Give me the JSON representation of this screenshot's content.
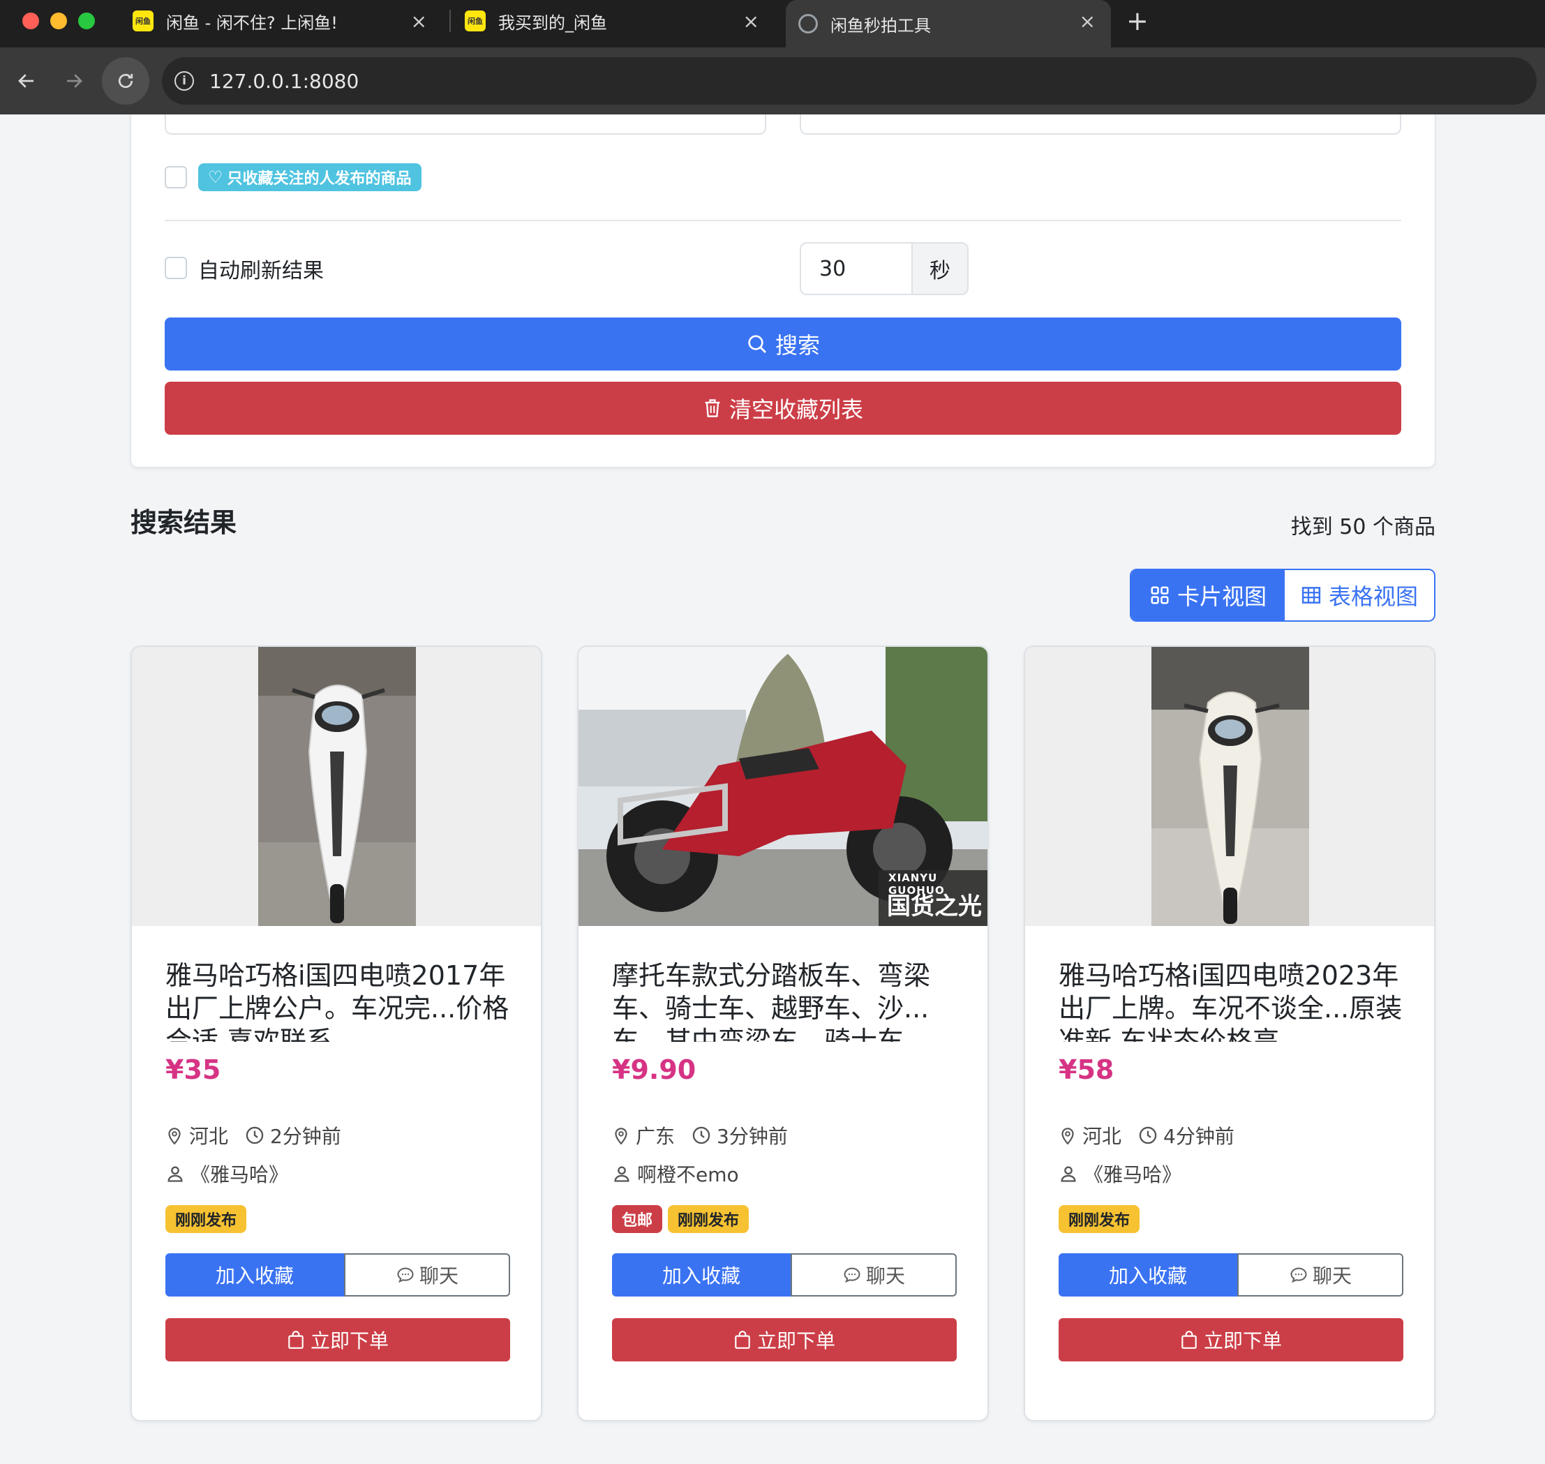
{
  "browser": {
    "tabs": [
      {
        "title": "闲鱼 - 闲不住? 上闲鱼!",
        "favicon": "xianyu-favicon"
      },
      {
        "title": "我买到的_闲鱼",
        "favicon": "xianyu-favicon"
      },
      {
        "title": "闲鱼秒拍工具",
        "favicon": "globe-icon",
        "active": true
      }
    ],
    "url": "127.0.0.1:8080"
  },
  "search_panel": {
    "follow_only_label": "只收藏关注的人发布的商品",
    "auto_refresh_label": "自动刷新结果",
    "refresh_interval": "30",
    "refresh_unit": "秒",
    "search_button": "搜索",
    "clear_button": "清空收藏列表"
  },
  "results": {
    "title": "搜索结果",
    "count_text": "找到 50 个商品",
    "view_card": "卡片视图",
    "view_table": "表格视图"
  },
  "items": [
    {
      "title": "雅马哈巧格i国四电喷2017年出厂上牌公户。车况完...价格合适 喜欢联系",
      "price": "¥35",
      "location": "河北",
      "time": "2分钟前",
      "seller": "《雅马哈》",
      "tags": [
        "刚刚发布"
      ],
      "fav_button": "加入收藏",
      "chat_button": "聊天",
      "order_button": "立即下单",
      "image": "white-scooter-photo"
    },
    {
      "title": "摩托车款式分踏板车、弯梁车、骑士车、越野车、沙...车、其中弯梁车、骑士车",
      "price": "¥9.90",
      "location": "广东",
      "time": "3分钟前",
      "seller": "啊橙不emo",
      "tags": [
        "包邮",
        "刚刚发布"
      ],
      "fav_button": "加入收藏",
      "chat_button": "聊天",
      "order_button": "立即下单",
      "image": "red-motorcycle-photo",
      "image_caption_top": "XIANYU GUOHUO",
      "image_caption_bottom": "国货之光"
    },
    {
      "title": "雅马哈巧格i国四电喷2023年出厂上牌。车况不谈全...原装准新 车状态价格高",
      "price": "¥58",
      "location": "河北",
      "time": "4分钟前",
      "seller": "《雅马哈》",
      "tags": [
        "刚刚发布"
      ],
      "fav_button": "加入收藏",
      "chat_button": "聊天",
      "order_button": "立即下单",
      "image": "cream-scooter-photo"
    }
  ],
  "colors": {
    "primary": "#3a73f2",
    "danger": "#cc3e47",
    "price": "#d63384",
    "warning": "#f6c232",
    "info": "#4fc3e0"
  }
}
